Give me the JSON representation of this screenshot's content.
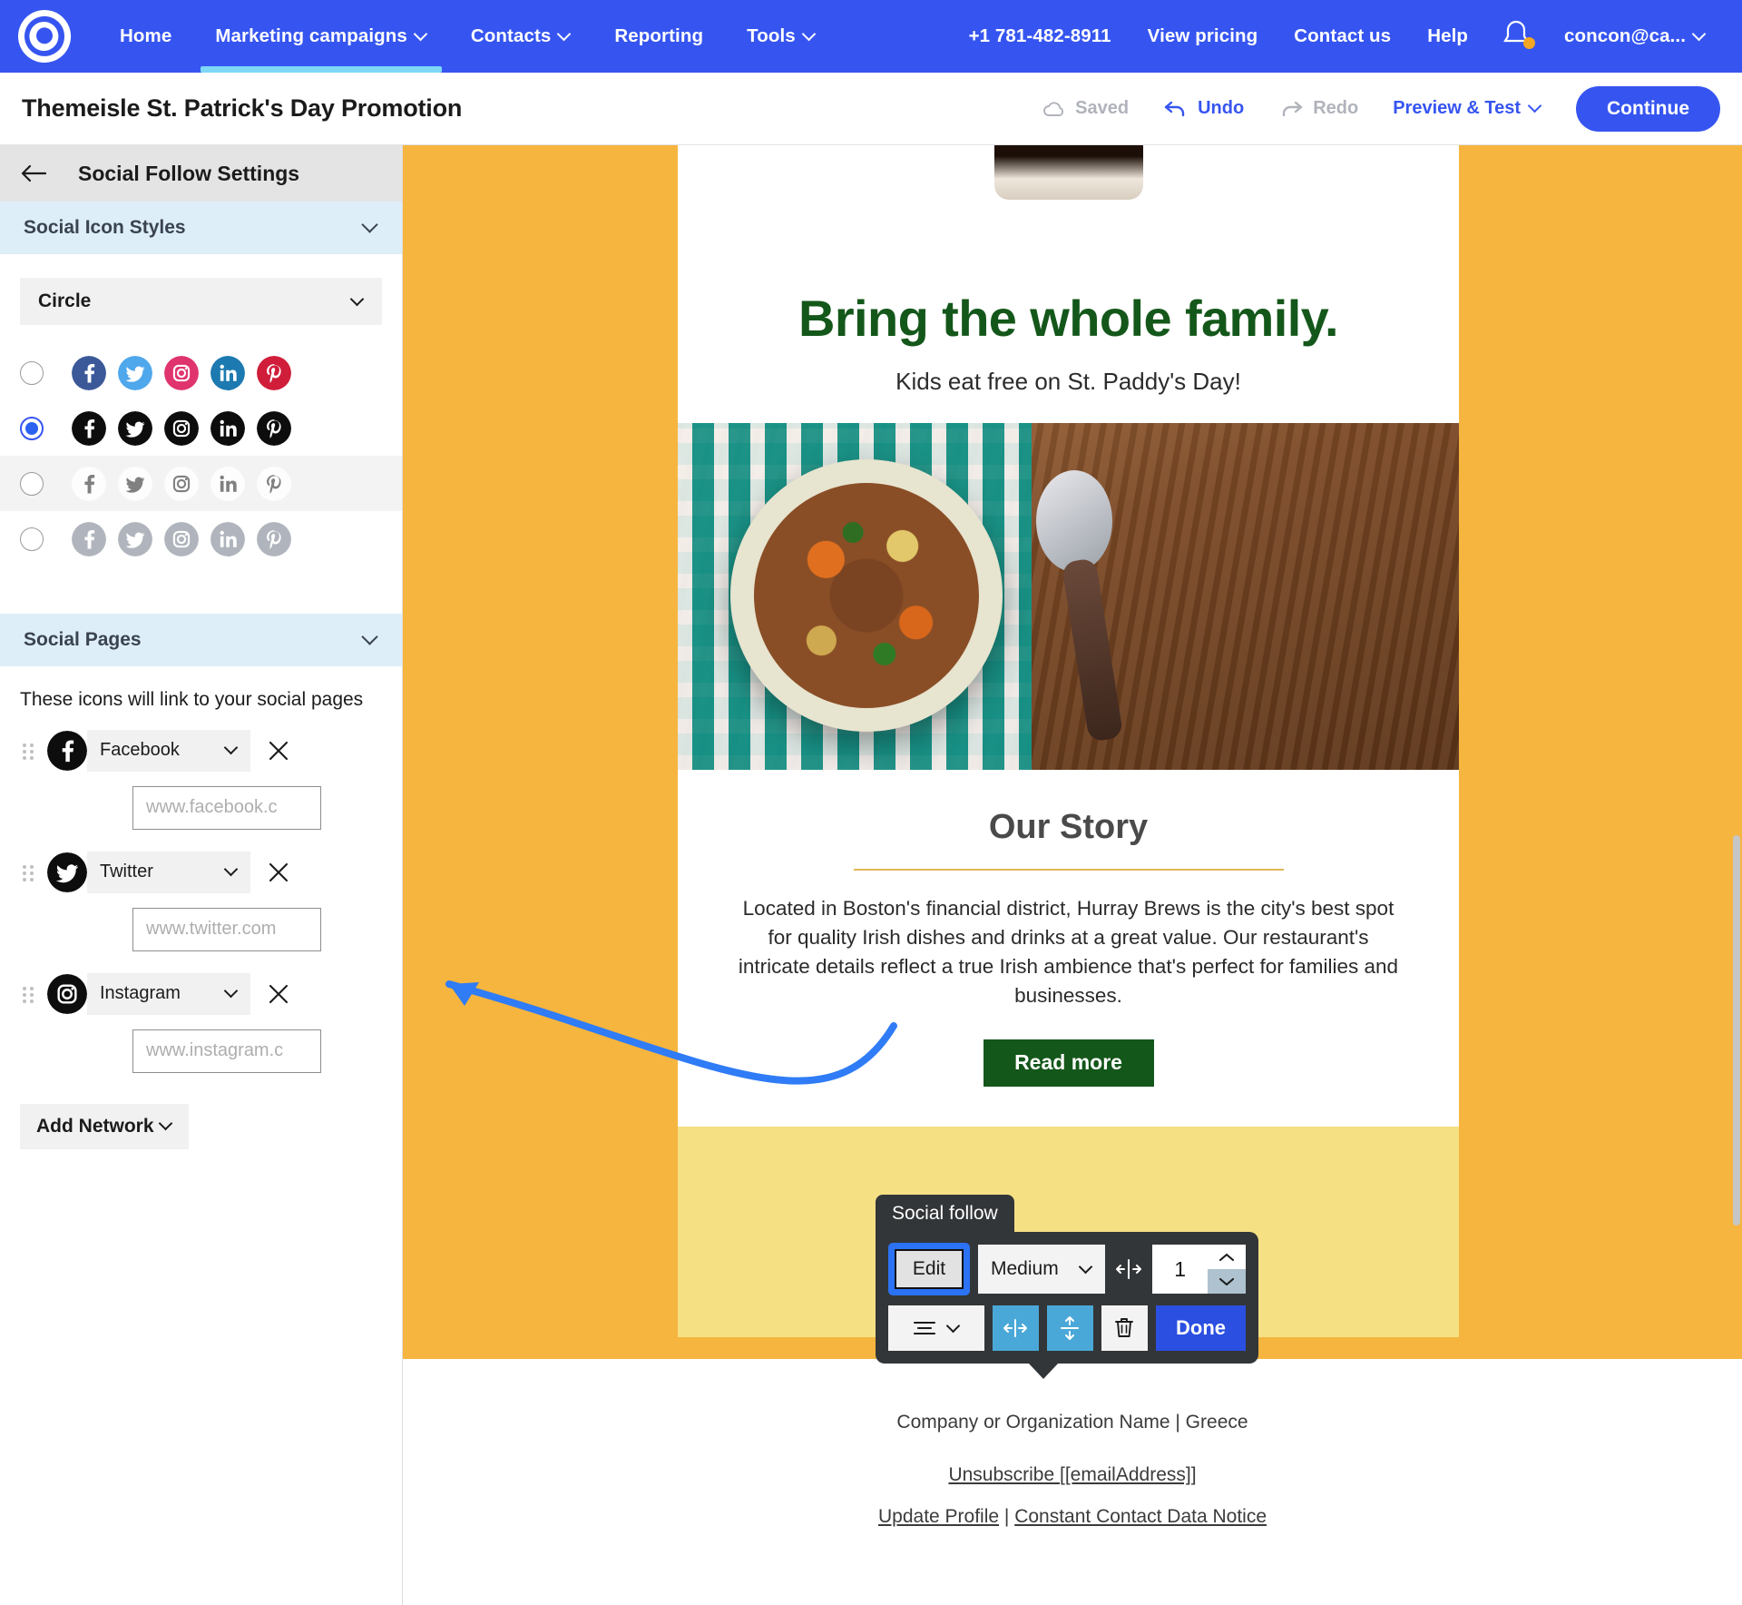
{
  "topnav": {
    "logo_icon": "constant-contact-logo",
    "left_items": [
      {
        "label": "Home",
        "has_caret": false,
        "active": false
      },
      {
        "label": "Marketing campaigns",
        "has_caret": true,
        "active": true
      },
      {
        "label": "Contacts",
        "has_caret": true,
        "active": false
      },
      {
        "label": "Reporting",
        "has_caret": false,
        "active": false
      },
      {
        "label": "Tools",
        "has_caret": true,
        "active": false
      }
    ],
    "right_items": [
      {
        "label": "+1 781-482-8911",
        "has_caret": false
      },
      {
        "label": "View pricing",
        "has_caret": false
      },
      {
        "label": "Contact us",
        "has_caret": false
      },
      {
        "label": "Help",
        "has_caret": false
      }
    ],
    "notification_icon": "bell-icon",
    "account_label": "concon@ca..."
  },
  "subheader": {
    "campaign_title": "Themeisle St. Patrick's Day Promotion",
    "saved_label": "Saved",
    "undo_label": "Undo",
    "redo_label": "Redo",
    "preview_label": "Preview & Test",
    "continue_label": "Continue"
  },
  "sidebar": {
    "back_icon": "back-arrow-icon",
    "panel_title": "Social Follow Settings",
    "icon_styles": {
      "section_label": "Social Icon Styles",
      "shape_select_value": "Circle",
      "networks": [
        "facebook",
        "twitter",
        "instagram",
        "linkedin",
        "pinterest"
      ],
      "rows": [
        {
          "style": "color",
          "selected": false
        },
        {
          "style": "black",
          "selected": true
        },
        {
          "style": "white-on-light",
          "selected": false
        },
        {
          "style": "gray",
          "selected": false
        }
      ]
    },
    "social_pages": {
      "section_label": "Social Pages",
      "description": "These icons will link to your social pages",
      "items": [
        {
          "network": "facebook",
          "name": "Facebook",
          "url_value": "",
          "url_placeholder": "www.facebook.c"
        },
        {
          "network": "twitter",
          "name": "Twitter",
          "url_value": "",
          "url_placeholder": "www.twitter.com"
        },
        {
          "network": "instagram",
          "name": "Instagram",
          "url_value": "",
          "url_placeholder": "www.instagram.c"
        }
      ],
      "add_network_label": "Add Network",
      "remove_icon": "close-icon",
      "drag_icon": "drag-handle-icon"
    }
  },
  "email": {
    "headline": "Bring the whole family.",
    "subheadline": "Kids eat free on St. Paddy's Day!",
    "hero_image_alt": "irish-stew-bowl-image",
    "top_image_alt": "stout-beer-glass-image",
    "story_title": "Our Story",
    "story_body": "Located in Boston's financial district, Hurray Brews is the city's best spot for quality Irish dishes and drinks at a great value. Our restaurant's intricate details reflect a true Irish ambience that's perfect for families and businesses.",
    "read_more_label": "Read more",
    "social_icons": [
      "facebook",
      "twitter",
      "instagram"
    ],
    "colors": {
      "canvas_bg": "#f5b53f",
      "headline_green": "#14571a",
      "band_yellow": "#f5e084",
      "rule_gold": "#dfb857"
    }
  },
  "footer": {
    "org_line": "Company or Organization Name | Greece",
    "unsubscribe_label": "Unsubscribe ",
    "email_token": "[[emailAddress]]",
    "update_profile_label": "Update Profile",
    "separator": " | ",
    "data_notice_label": "Constant Contact Data Notice"
  },
  "toolbar": {
    "tag_label": "Social follow",
    "edit_label": "Edit",
    "size_value": "Medium",
    "spacing_icon": "horizontal-spacing-icon",
    "count_value": "1",
    "align_icon": "align-icon",
    "hspace_icon": "horizontal-space-icon",
    "vspace_icon": "vertical-space-icon",
    "delete_icon": "trash-icon",
    "done_label": "Done",
    "accent_blue": "#2b72f4",
    "done_blue": "#2b4fe0",
    "tool_blue": "#4aa8d8"
  }
}
